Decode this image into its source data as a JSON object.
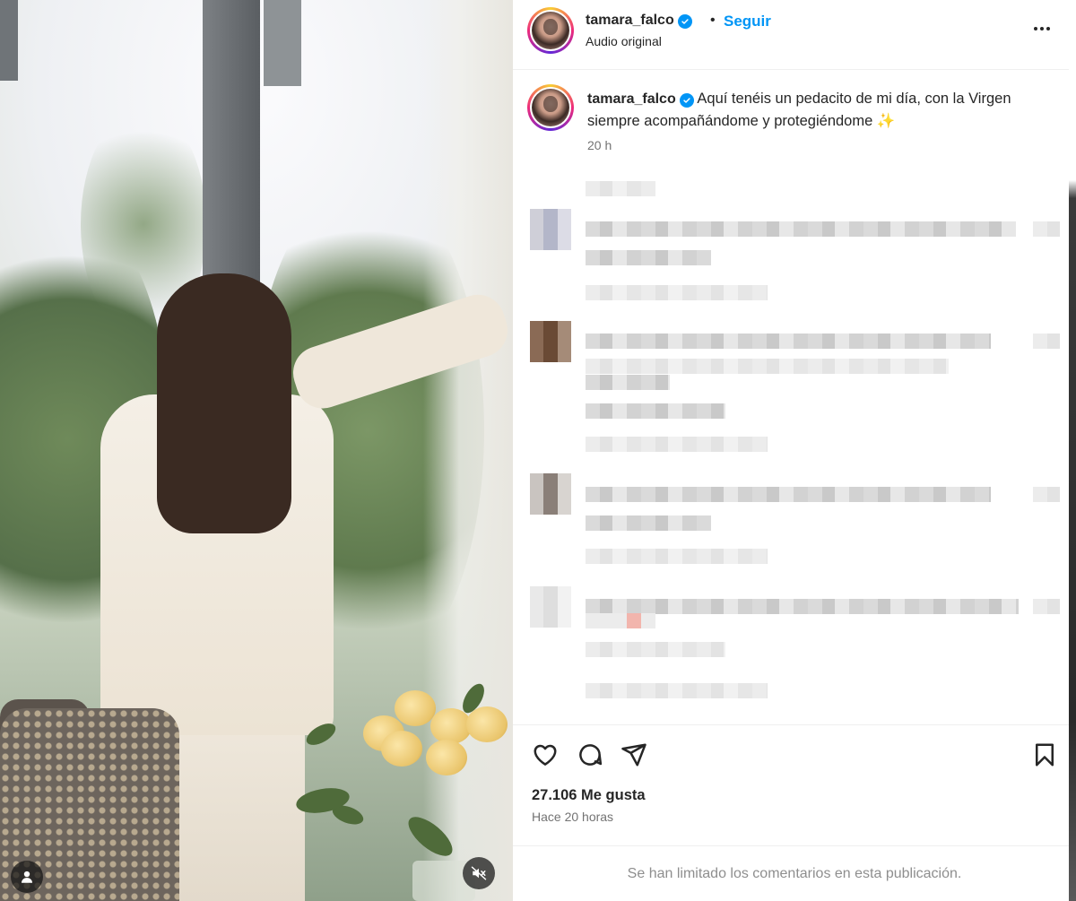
{
  "post": {
    "username": "tamara_falco",
    "separator": "•",
    "follow_label": "Seguir",
    "audio_label": "Audio original",
    "caption_text": "Aquí tenéis un pedacito de mi día, con la Virgen siempre acompañándome y protegiéndome ✨",
    "caption_time": "20 h",
    "likes": "27.106 Me gusta",
    "posted_ago": "Hace 20 horas",
    "comments_limited": "Se han limitado los comentarios en esta publicación."
  },
  "icons": {
    "verified": "verified-badge-icon",
    "more": "more-options-icon",
    "like": "heart-icon",
    "comment": "comment-icon",
    "share": "send-icon",
    "save": "bookmark-icon",
    "tag": "user-tag-icon",
    "mute": "audio-muted-icon"
  },
  "colors": {
    "accent": "#0095f6",
    "text": "#262626",
    "muted": "#737373"
  }
}
